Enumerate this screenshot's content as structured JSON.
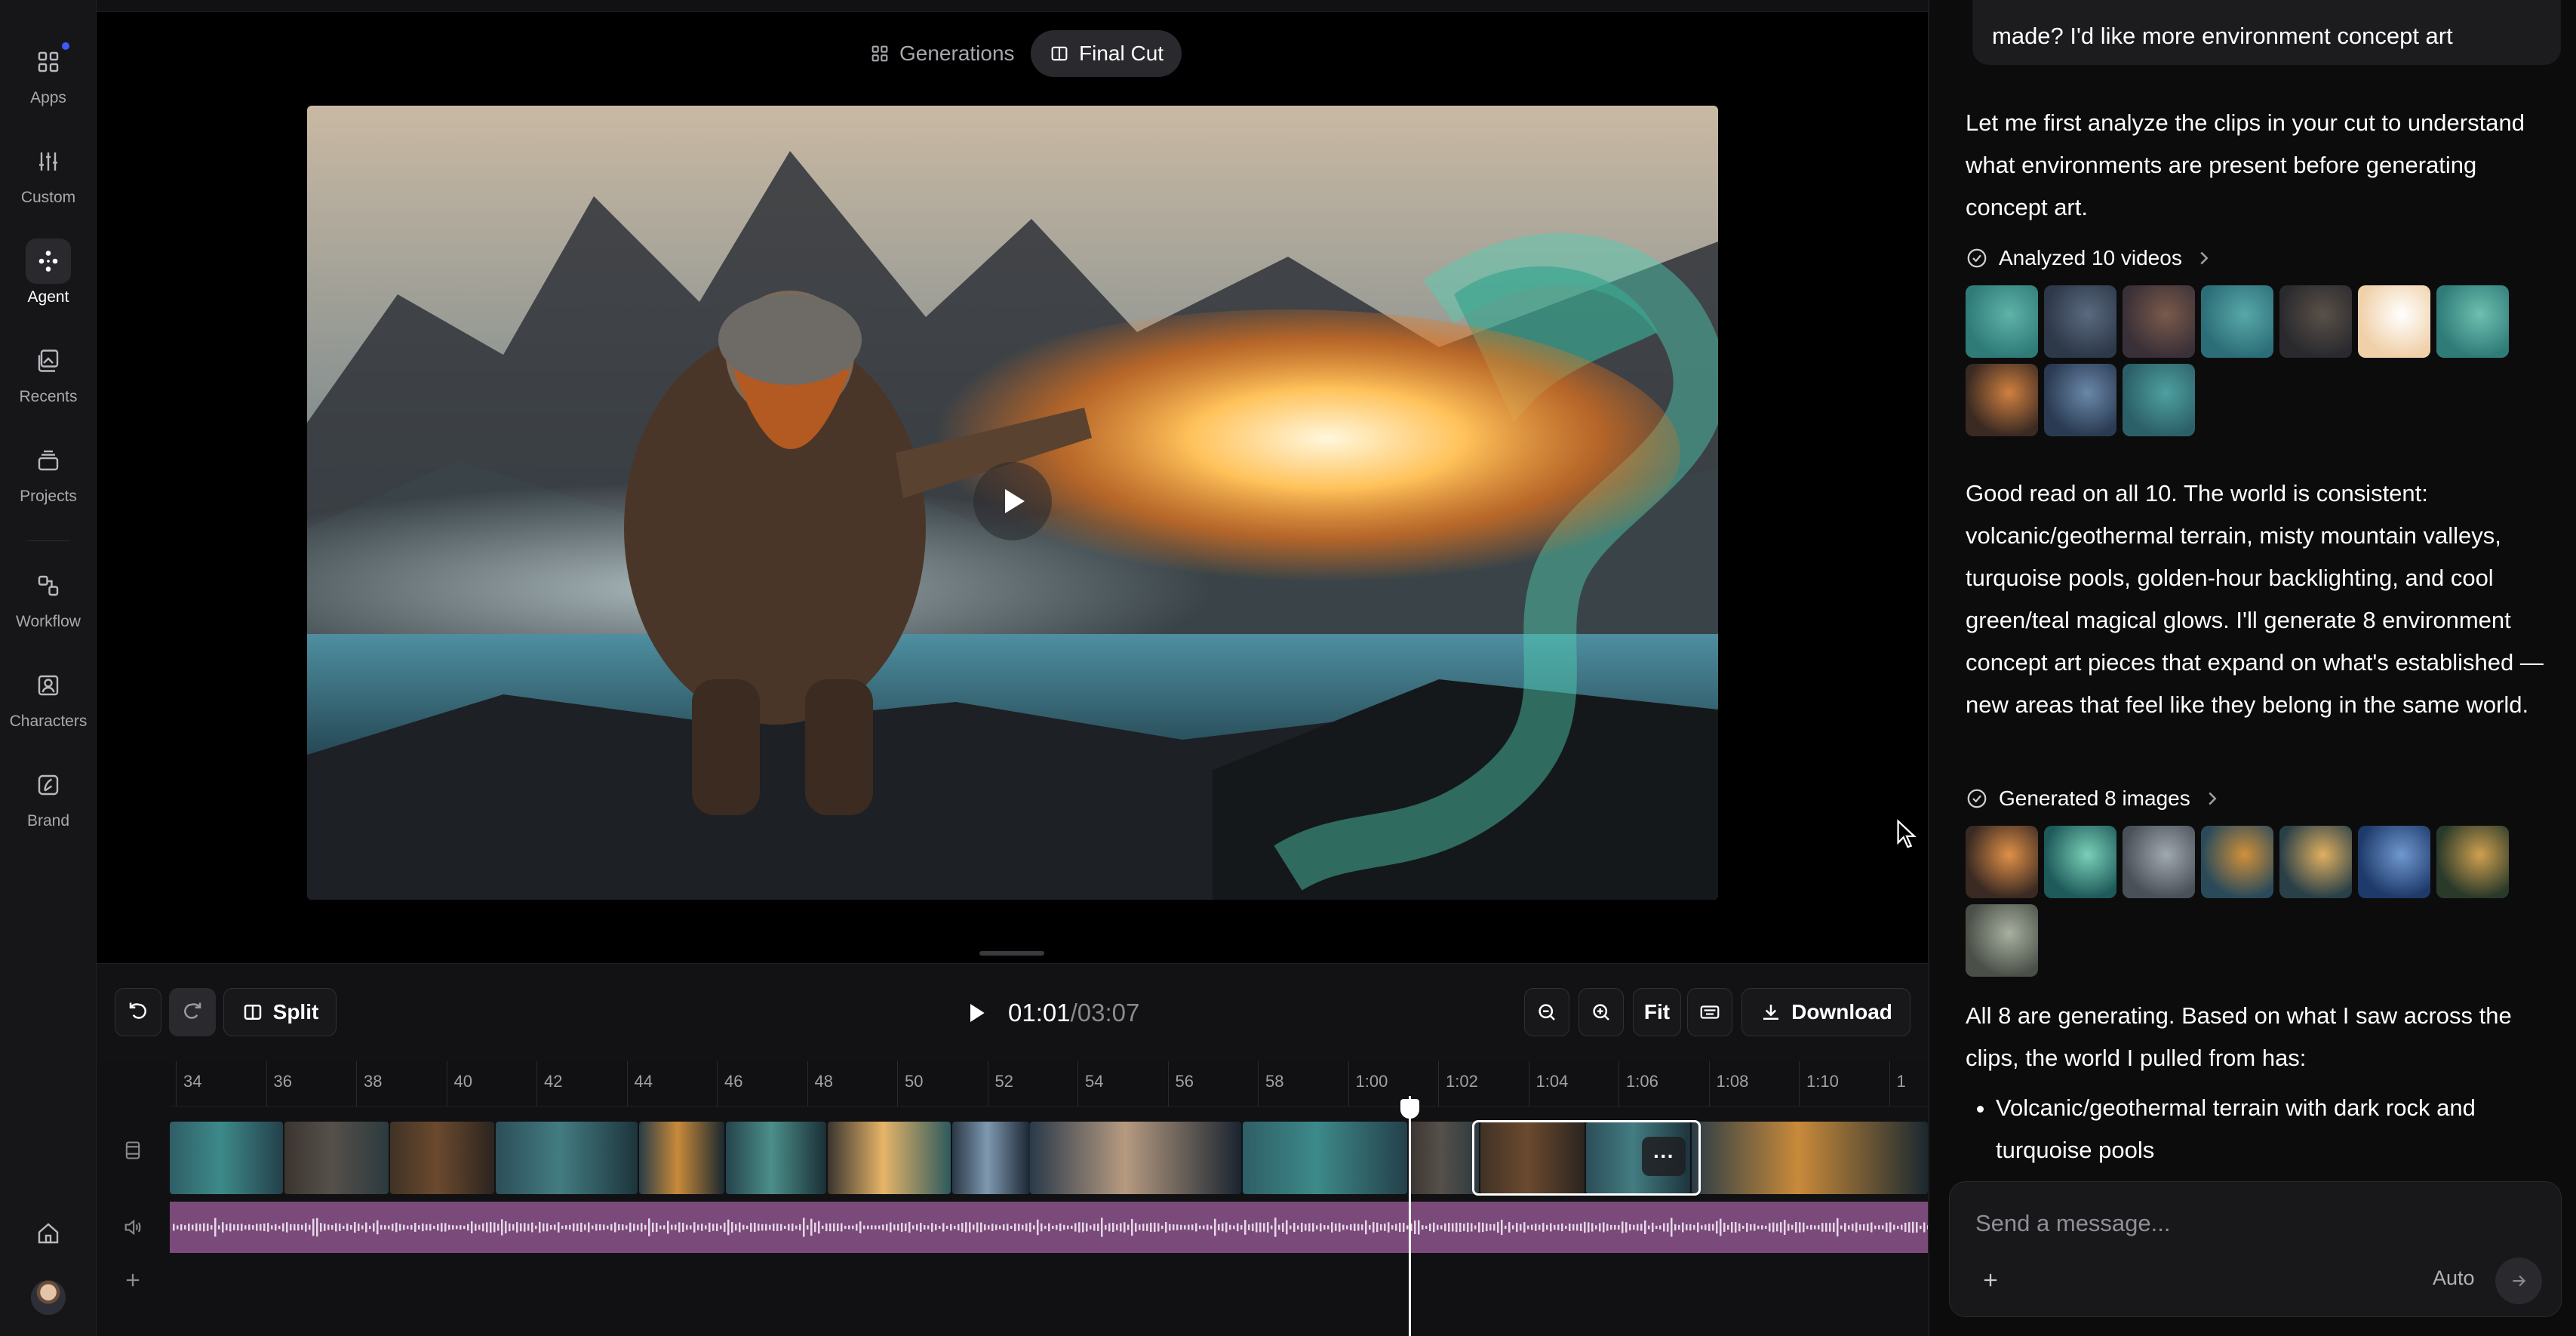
{
  "nav": {
    "items": [
      {
        "label": "Apps",
        "icon": "apps-grid-icon"
      },
      {
        "label": "Custom",
        "icon": "sliders-icon"
      },
      {
        "label": "Agent",
        "icon": "agent-icon",
        "active": true
      },
      {
        "label": "Recents",
        "icon": "recents-images-icon"
      },
      {
        "label": "Projects",
        "icon": "projects-stack-icon"
      },
      {
        "label": "Workflow",
        "icon": "workflow-icon"
      },
      {
        "label": "Characters",
        "icon": "characters-icon"
      },
      {
        "label": "Brand",
        "icon": "brand-icon"
      }
    ],
    "bottom": {
      "home_icon": "home-icon",
      "avatar": "user-avatar"
    }
  },
  "view_tabs": [
    {
      "label": "Generations",
      "icon": "grid-icon"
    },
    {
      "label": "Final Cut",
      "icon": "film-cut-icon",
      "active": true
    }
  ],
  "toolbar": {
    "undo_icon": "undo-icon",
    "redo_icon": "redo-icon",
    "split_label": "Split",
    "current_time": "01:01",
    "total_time": "/03:07",
    "fit_label": "Fit",
    "download_label": "Download"
  },
  "timeline": {
    "ticks": [
      "34",
      "36",
      "38",
      "40",
      "42",
      "44",
      "46",
      "48",
      "50",
      "52",
      "54",
      "56",
      "58",
      "1:00",
      "1:02",
      "1:04",
      "1:06",
      "1:08",
      "1:10",
      "1"
    ],
    "playhead_label": "01:01"
  },
  "chat": {
    "user_message_tail": "made? I'd like more environment concept art",
    "assistant_intro": "Let me first analyze the clips in your cut to understand what environments are present before generating concept art.",
    "tool1_label": "Analyzed 10 videos",
    "tool1_count": 10,
    "assistant_analysis": "Good read on all 10. The world is consistent: volcanic/geothermal terrain, misty mountain valleys, turquoise pools, golden-hour backlighting, and cool green/teal magical glows. I'll generate 8 environment concept art pieces that expand on what's established — new areas that feel like they belong in the same world.",
    "tool2_label": "Generated 8 images",
    "tool2_count": 8,
    "assistant_followup": "All 8 are generating. Based on what I saw across the clips, the world I pulled from has:",
    "bullets": [
      "Volcanic/geothermal terrain with dark rock and turquoise pools"
    ],
    "composer": {
      "placeholder": "Send a message...",
      "mode": "Auto"
    }
  },
  "colors": {
    "accent_dot": "#3b5bff",
    "audio_track": "#7a4b7a",
    "panel_bg": "#0c0c0d"
  }
}
